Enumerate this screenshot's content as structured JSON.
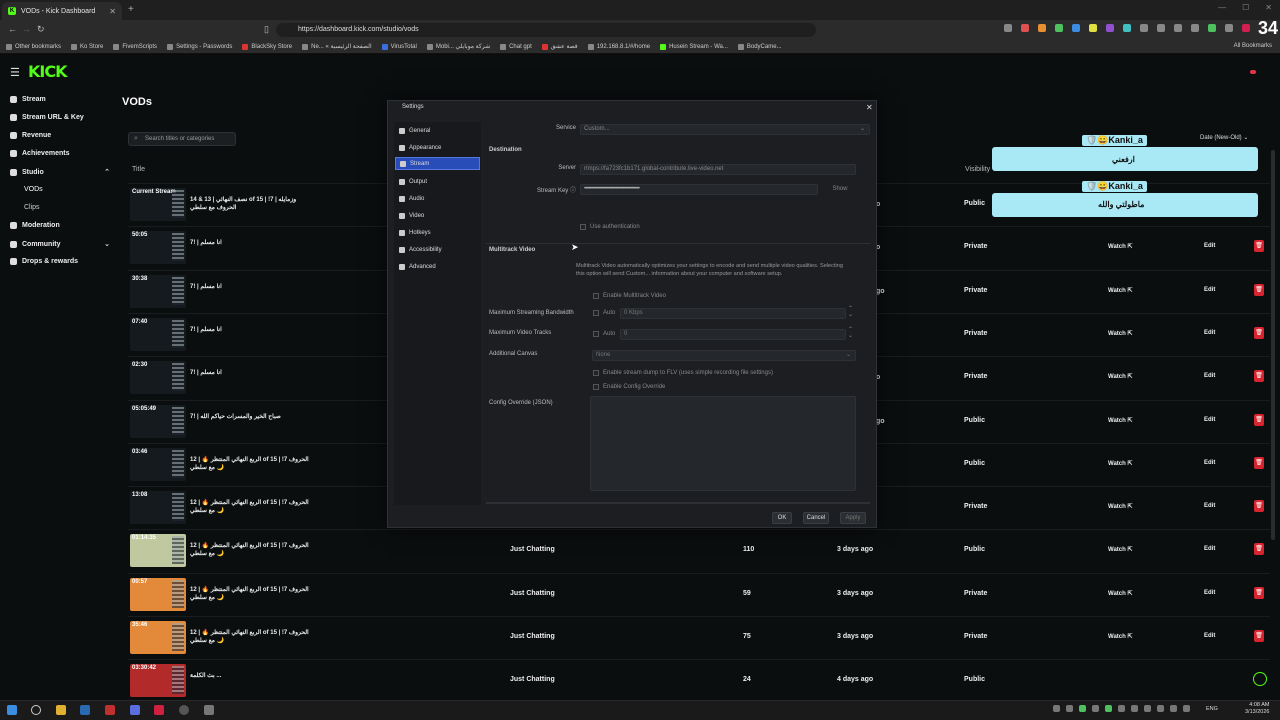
{
  "browser": {
    "tab_title": "VODs - Kick Dashboard",
    "url": "https://dashboard.kick.com/studio/vods",
    "bookmarks": [
      "Other bookmarks",
      "Ko Store",
      "FivemScripts",
      "Settings - Passwords",
      "BlackSky Store",
      "Ne... « الصفحة الرئيسية",
      "VirusTotal",
      "Mobi... شركة موبايلي",
      "Chat gpt",
      "قصة عشق",
      "192.168.8.1/#/home",
      "Husein Stream - Wa...",
      "BodyCame..."
    ],
    "all_bookmarks": "All Bookmarks",
    "overlay_number": "34"
  },
  "sidebar": {
    "items": [
      {
        "label": "Stream",
        "icon": "stream-icon"
      },
      {
        "label": "Stream URL & Key",
        "icon": "key-icon"
      },
      {
        "label": "Revenue",
        "icon": "dollar-icon"
      },
      {
        "label": "Achievements",
        "icon": "trophy-icon"
      },
      {
        "label": "Studio",
        "icon": "studio-icon"
      },
      {
        "label": "VODs",
        "icon": ""
      },
      {
        "label": "Clips",
        "icon": ""
      },
      {
        "label": "Moderation",
        "icon": "shield-icon"
      },
      {
        "label": "Community",
        "icon": "community-icon"
      },
      {
        "label": "Drops & rewards",
        "icon": "gift-icon"
      }
    ]
  },
  "page": {
    "title": "VODs",
    "search_placeholder": "Search titles or categories",
    "sort_label": "Date (New-Old)",
    "col_title": "Title",
    "col_visibility": "Visibility"
  },
  "rows": [
    {
      "duration": "Current Stream",
      "title": "نصف النهائي | 13 & 14 of 15 | !7 وزمايله | الحروف مع سلطي",
      "category": "",
      "views": "",
      "date": "",
      "visibility": "Public",
      "watch": "",
      "edit": ""
    },
    {
      "duration": "50:05",
      "title": "انا مسلم | !7",
      "category": "",
      "views": "",
      "date": "",
      "visibility": "Private",
      "watch": "Watch",
      "edit": "Edit"
    },
    {
      "duration": "30:38",
      "title": "انا مسلم | !7",
      "category": "",
      "views": "",
      "date": "",
      "visibility": "Private",
      "watch": "Watch",
      "edit": "Edit"
    },
    {
      "duration": "07:40",
      "title": "انا مسلم | !7",
      "category": "",
      "views": "",
      "date": "",
      "visibility": "Private",
      "watch": "Watch",
      "edit": "Edit"
    },
    {
      "duration": "02:30",
      "title": "انا مسلم | !7",
      "category": "",
      "views": "",
      "date": "",
      "visibility": "Private",
      "watch": "Watch",
      "edit": "Edit"
    },
    {
      "duration": "05:05:49",
      "title": "صباح الخير والمسرات حياكم الله | !7",
      "category": "",
      "views": "",
      "date": "",
      "visibility": "Public",
      "watch": "Watch",
      "edit": "Edit"
    },
    {
      "duration": "03:46",
      "title": "الربع النهائي المنتظر 🔥 | 12 of 15 | !7 الحروف مع سلطي 🌙",
      "category": "",
      "views": "",
      "date": "",
      "visibility": "Public",
      "watch": "Watch",
      "edit": "Edit"
    },
    {
      "duration": "13:08",
      "title": "الربع النهائي المنتظر 🔥 | 12 of 15 | !7 الحروف مع سلطي 🌙",
      "category": "",
      "views": "",
      "date": "",
      "visibility": "Private",
      "watch": "Watch",
      "edit": "Edit"
    },
    {
      "duration": "01:14:35",
      "title": "الربع النهائي المنتظر 🔥 | 12 of 15 | !7 الحروف مع سلطي 🌙",
      "category": "Just Chatting",
      "views": "110",
      "date": "3 days ago",
      "visibility": "Public",
      "watch": "Watch",
      "edit": "Edit"
    },
    {
      "duration": "00:57",
      "title": "الربع النهائي المنتظر 🔥 | 12 of 15 | !7 الحروف مع سلطي 🌙",
      "category": "Just Chatting",
      "views": "59",
      "date": "3 days ago",
      "visibility": "Private",
      "watch": "Watch",
      "edit": "Edit"
    },
    {
      "duration": "35:46",
      "title": "الربع النهائي المنتظر 🔥 | 12 of 15 | !7 الحروف مع سلطي 🌙",
      "category": "Just Chatting",
      "views": "75",
      "date": "3 days ago",
      "visibility": "Private",
      "watch": "Watch",
      "edit": "Edit"
    },
    {
      "duration": "03:30:42",
      "title": "بث الكلمة ...",
      "category": "Just Chatting",
      "views": "24",
      "date": "4 days ago",
      "visibility": "Public",
      "watch": "",
      "edit": ""
    }
  ],
  "side_letters": [
    "o",
    "o",
    "go",
    "o",
    "go"
  ],
  "chat": [
    {
      "name": "Kanki_a",
      "text": "ارفعني"
    },
    {
      "name": "Kanki_a",
      "text": "ماطولتي والله"
    }
  ],
  "settings": {
    "title": "Settings",
    "nav": [
      "General",
      "Appearance",
      "Stream",
      "Output",
      "Audio",
      "Video",
      "Hotkeys",
      "Accessibility",
      "Advanced"
    ],
    "active_nav": "Stream",
    "service_label": "Service",
    "service_value": "Custom...",
    "destination": "Destination",
    "server_label": "Server",
    "server_value": "rtmps://fa723fc1b171.global-contribute.live-video.net",
    "stream_key_label": "Stream Key",
    "stream_key_value": "••••••••••••••••••••••••••••••••••••••••••••••••••",
    "show_btn": "Show",
    "use_auth": "Use authentication",
    "multitrack_title": "Multitrack Video",
    "multitrack_desc": "Multitrack Video automatically optimizes your settings to encode and send multiple video qualities. Selecting this option will send Custom... information about your computer and software setup.",
    "enable_multitrack": "Enable Multitrack Video",
    "max_bw_label": "Maximum Streaming Bandwidth",
    "max_bw_auto": "Auto",
    "max_bw_value": "0 Kbps",
    "max_tracks_label": "Maximum Video Tracks",
    "max_tracks_auto": "Auto",
    "max_tracks_value": "0",
    "additional_canvas_label": "Additional Canvas",
    "additional_canvas_value": "None",
    "enable_dump": "Enable stream dump to FLV (uses simple recording file settings)",
    "enable_config_override": "Enable Config Override",
    "config_override_label": "Config Override (JSON)",
    "ok": "OK",
    "cancel": "Cancel",
    "apply": "Apply"
  },
  "taskbar": {
    "lang": "ENG",
    "time": "4:08 AM",
    "date": "3/13/2026"
  }
}
